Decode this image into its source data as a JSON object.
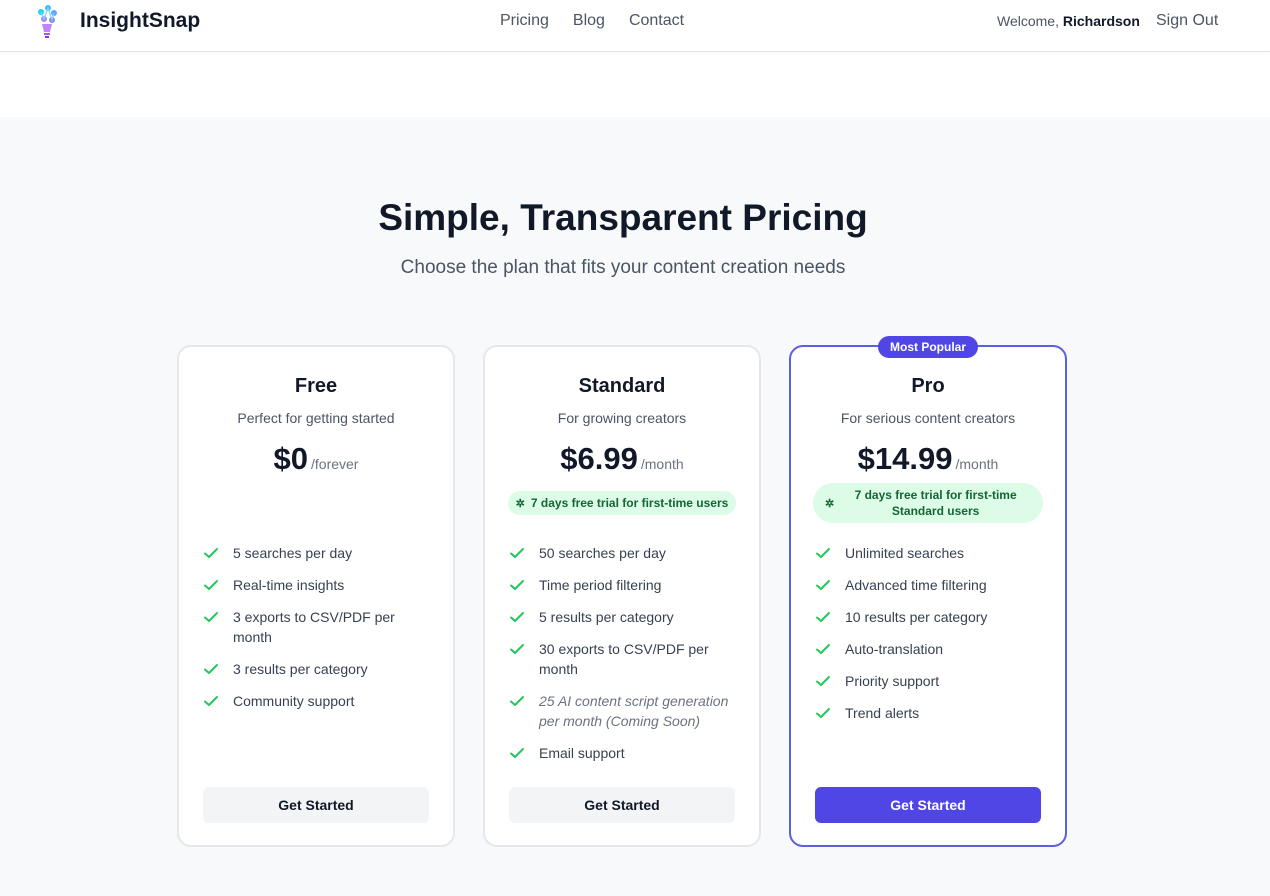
{
  "nav": {
    "brand": "InsightSnap",
    "links": [
      "Pricing",
      "Blog",
      "Contact"
    ],
    "welcome_prefix": "Welcome,",
    "username": "Richardson",
    "sign_out": "Sign Out"
  },
  "hero": {
    "title": "Simple, Transparent Pricing",
    "subtitle": "Choose the plan that fits your content creation needs"
  },
  "plans": [
    {
      "name": "Free",
      "description": "Perfect for getting started",
      "price": "$0",
      "period": "/forever",
      "features": [
        "5 searches per day",
        "Real-time insights",
        "3 exports to CSV/PDF per month",
        "3 results per category",
        "Community support"
      ],
      "cta": "Get Started"
    },
    {
      "name": "Standard",
      "description": "For growing creators",
      "price": "$6.99",
      "period": "/month",
      "trial": "7 days free trial for first-time users",
      "features": [
        "50 searches per day",
        "Time period filtering",
        "5 results per category",
        "30 exports to CSV/PDF per month",
        "25 AI content script generation per month (Coming Soon)",
        "Email support"
      ],
      "cta": "Get Started"
    },
    {
      "name": "Pro",
      "badge": "Most Popular",
      "description": "For serious content creators",
      "price": "$14.99",
      "period": "/month",
      "trial": "7 days free trial for first-time Standard users",
      "features": [
        "Unlimited searches",
        "Advanced time filtering",
        "10 results per category",
        "Auto-translation",
        "Priority support",
        "Trend alerts"
      ],
      "cta": "Get Started"
    }
  ],
  "colors": {
    "accent": "#4f46e5",
    "check": "#22c55e",
    "trial_bg": "#dcfce7",
    "section_bg": "#f8f9fb"
  }
}
